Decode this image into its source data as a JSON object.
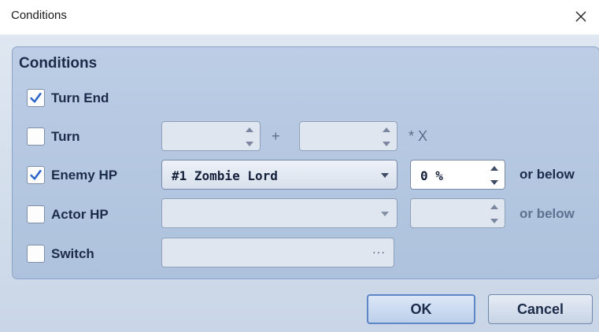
{
  "window": {
    "title": "Conditions",
    "close_icon": "close-icon"
  },
  "group": {
    "title": "Conditions"
  },
  "rows": {
    "turn_end": {
      "label": "Turn End",
      "checked": true
    },
    "turn": {
      "label": "Turn",
      "checked": false,
      "value_a": "",
      "plus": "+",
      "value_b": "",
      "suffix": "* X"
    },
    "enemy_hp": {
      "label": "Enemy HP",
      "checked": true,
      "enemy": "#1 Zombie Lord",
      "percent": "0 %",
      "suffix": "or below"
    },
    "actor_hp": {
      "label": "Actor HP",
      "checked": false,
      "actor": "",
      "percent": "",
      "suffix": "or below"
    },
    "switch": {
      "label": "Switch",
      "checked": false,
      "value": "",
      "browse": "···"
    }
  },
  "buttons": {
    "ok": "OK",
    "cancel": "Cancel"
  },
  "colors": {
    "accent": "#3b6fd0",
    "group_bg": "#b5c8e1",
    "text": "#1c2b4a"
  }
}
